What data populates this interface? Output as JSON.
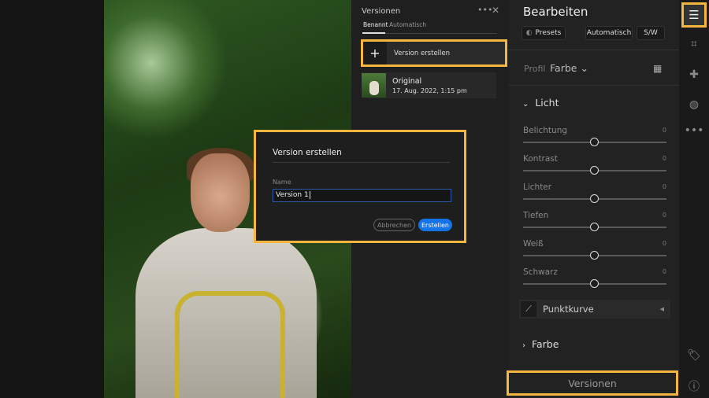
{
  "versions_panel": {
    "title": "Versionen",
    "tabs": [
      "Benannt",
      "Automatisch"
    ],
    "create_label": "Version erstellen",
    "items": [
      {
        "name": "Original",
        "date": "17. Aug. 2022, 1:15 pm"
      }
    ]
  },
  "dialog": {
    "title": "Version erstellen",
    "name_label": "Name",
    "name_value": "Version 1",
    "cancel": "Abbrechen",
    "confirm": "Erstellen"
  },
  "edit_panel": {
    "title": "Bearbeiten",
    "presets": "Presets",
    "auto": "Automatisch",
    "bw": "S/W",
    "profile_label": "Profil",
    "profile_value": "Farbe",
    "light_section": "Licht",
    "sliders": [
      {
        "label": "Belichtung",
        "value": "0"
      },
      {
        "label": "Kontrast",
        "value": "0"
      },
      {
        "label": "Lichter",
        "value": "0"
      },
      {
        "label": "Tiefen",
        "value": "0"
      },
      {
        "label": "Weiß",
        "value": "0"
      },
      {
        "label": "Schwarz",
        "value": "0"
      }
    ],
    "curve": "Punktkurve",
    "color_section": "Farbe",
    "versions_button": "Versionen"
  },
  "colors": {
    "highlight": "#f4b63f",
    "accent": "#1473e6"
  }
}
